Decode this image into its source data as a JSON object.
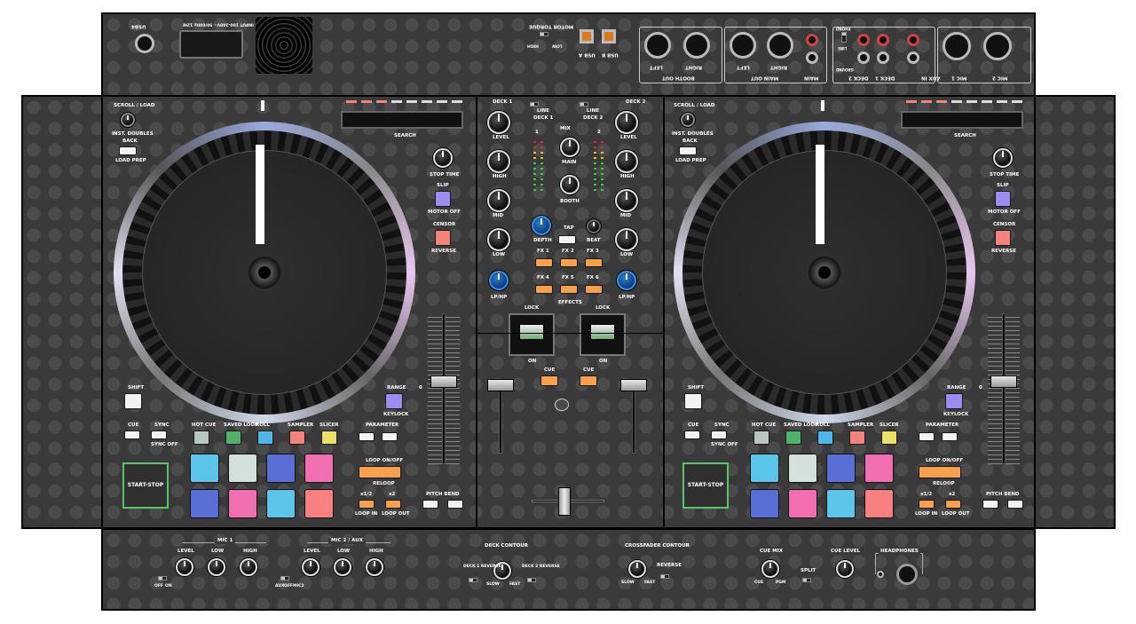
{
  "top": {
    "usb4": "USB4",
    "power": "AC INPUT 100-240V~ 50/60Hz 12W",
    "motor_torque": "MOTOR TORQUE",
    "motor_high": "HIGH",
    "motor_low": "LOW",
    "usb_a": "USB A",
    "usb_b": "USB B",
    "booth_out": "BOOTH OUT",
    "main_out": "MAIN OUT",
    "main_label": "MAIN",
    "left": "LEFT",
    "right": "RIGHT",
    "deck2": "DECK 2",
    "deck1": "DECK 1",
    "aux_in": "AUX IN",
    "mic1": "MIC 1",
    "mic2": "MIC 2",
    "phono": "PHONO",
    "line": "LINE",
    "ground": "GROUND",
    "r": "R",
    "l": "L"
  },
  "deck_left": {
    "scroll_load": "SCROLL / LOAD",
    "inst_doubles": "INST. DOUBLES",
    "back": "BACK",
    "load_prep": "LOAD PREP",
    "search": "SEARCH",
    "stop_time": "STOP TIME",
    "slip": "SLIP",
    "motor_off": "MOTOR OFF",
    "censor": "CENSOR",
    "reverse": "REVERSE",
    "shift": "SHIFT",
    "range": "RANGE",
    "keylock": "KEYLOCK",
    "cue": "CUE",
    "sync": "SYNC",
    "sync_off": "SYNC OFF",
    "hot_cue": "HOT CUE",
    "saved_loop": "SAVED LOOP",
    "roll": "ROLL",
    "sampler": "SAMPLER",
    "slicer": "SLICER",
    "parameter": "PARAMETER",
    "loop_onoff": "LOOP ON/OFF",
    "reloop": "RELOOP",
    "half": "x1/2",
    "double": "x2",
    "loop_in": "LOOP IN",
    "loop_out": "LOOP OUT",
    "start_stop": "START-STOP",
    "pitch_bend": "PITCH BEND",
    "zero": "0"
  },
  "deck_right": {
    "scroll_load": "SCROLL / LOAD",
    "inst_doubles": "INST. DOUBLES",
    "back": "BACK",
    "load_prep": "LOAD PREP",
    "search": "SEARCH",
    "stop_time": "STOP TIME",
    "slip": "SLIP",
    "motor_off": "MOTOR OFF",
    "censor": "CENSOR",
    "reverse": "REVERSE",
    "shift": "SHIFT",
    "range": "RANGE",
    "keylock": "KEYLOCK",
    "cue": "CUE",
    "sync": "SYNC",
    "sync_off": "SYNC OFF",
    "hot_cue": "HOT CUE",
    "saved_loop": "SAVED LOOP",
    "roll": "ROLL",
    "sampler": "SAMPLER",
    "slicer": "SLICER",
    "parameter": "PARAMETER",
    "loop_onoff": "LOOP ON/OFF",
    "reloop": "RELOOP",
    "half": "x1/2",
    "double": "x2",
    "loop_in": "LOOP IN",
    "loop_out": "LOOP OUT",
    "start_stop": "START-STOP",
    "pitch_bend": "PITCH BEND",
    "zero": "0"
  },
  "mixer": {
    "deck1": "DECK 1",
    "deck2": "DECK 2",
    "line": "LINE",
    "level": "LEVEL",
    "high": "HIGH",
    "mid": "MID",
    "low": "LOW",
    "lphp": "LP/HP",
    "mix": "MIX",
    "main": "MAIN",
    "booth": "BOOTH",
    "depth": "DEPTH",
    "tap": "TAP",
    "beat": "BEAT",
    "fx1": "FX 1",
    "fx2": "FX 2",
    "fx3": "FX 3",
    "fx4": "FX 4",
    "fx5": "FX 5",
    "fx6": "FX 6",
    "effects": "EFFECTS",
    "lock": "LOCK",
    "on": "ON",
    "cue": "CUE",
    "one": "1",
    "two": "2",
    "off": "OFF"
  },
  "bottom": {
    "mic1": "MIC 1",
    "mic2_aux": "MIC 2 / AUX",
    "level": "LEVEL",
    "low": "LOW",
    "high": "HIGH",
    "off": "OFF",
    "on": "ON",
    "aux": "AUX",
    "mic2": "MIC2",
    "deck_contour": "DECK CONTOUR",
    "deck1_reverse": "DECK 1 REVERSE",
    "deck2_reverse": "DECK 2 REVERSE",
    "slow": "SLOW",
    "fast": "FAST",
    "crossfader_contour": "CROSSFADER CONTOUR",
    "reverse": "REVERSE",
    "cue_mix": "CUE MIX",
    "cue_lbl": "CUE",
    "pgm": "PGM",
    "split": "SPLIT",
    "cue_level": "CUE LEVEL",
    "headphones": "HEADPHONES"
  },
  "colors": {
    "white": "#f2f2f2",
    "lilac": "#9b8ef0",
    "salmon": "#f3837b",
    "gray_pad": "#b9c7c0",
    "green": "#4fb36b",
    "cyan": "#4fb8e8",
    "yellow": "#ece06a",
    "orange": "#f6a050",
    "blue_pad": "#5a6fd6",
    "pink": "#f06fb0",
    "pad_cyan": "#5cc6ea",
    "pad_light": "#d4e0da",
    "pad_salmon": "#f88080",
    "startstop": "#5ec26a"
  }
}
